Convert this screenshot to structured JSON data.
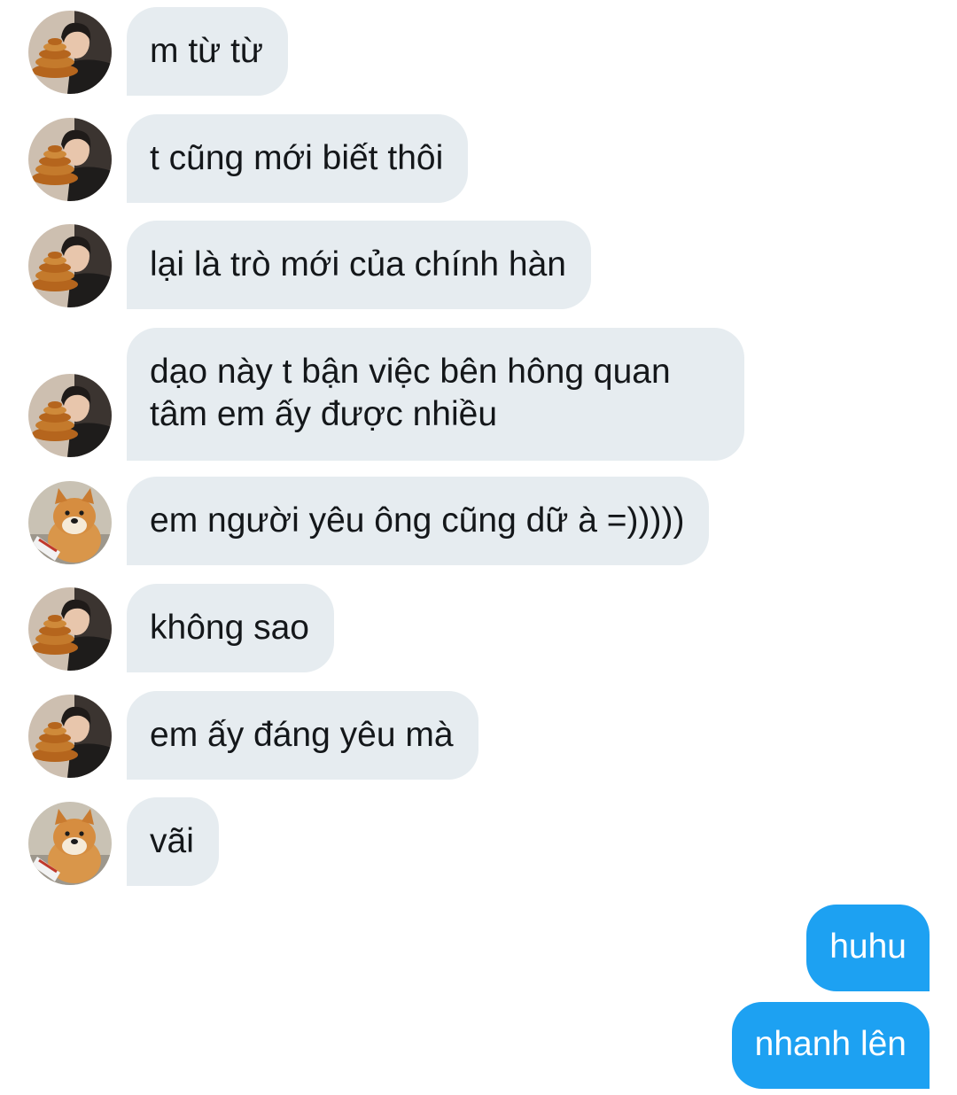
{
  "contacts": {
    "guy": {
      "icon": "person-avatar-icon"
    },
    "dog": {
      "icon": "shiba-dog-avatar-icon"
    }
  },
  "colors": {
    "incoming_bubble": "#e6ecf0",
    "outgoing_bubble": "#1da1f2",
    "incoming_text": "#14171a",
    "outgoing_text": "#ffffff"
  },
  "messages": [
    {
      "sender": "guy",
      "direction": "incoming",
      "text": "m từ từ"
    },
    {
      "sender": "guy",
      "direction": "incoming",
      "text": "t cũng mới biết thôi"
    },
    {
      "sender": "guy",
      "direction": "incoming",
      "text": "lại là trò mới của chính hàn"
    },
    {
      "sender": "guy",
      "direction": "incoming",
      "text": "dạo này t bận việc bên hông quan tâm em ấy được nhiều"
    },
    {
      "sender": "dog",
      "direction": "incoming",
      "text": "em người yêu ông cũng dữ à =)))))"
    },
    {
      "sender": "guy",
      "direction": "incoming",
      "text": "không sao"
    },
    {
      "sender": "guy",
      "direction": "incoming",
      "text": "em ấy đáng yêu mà"
    },
    {
      "sender": "dog",
      "direction": "incoming",
      "text": "vãi"
    },
    {
      "sender": "me",
      "direction": "outgoing",
      "text": "huhu"
    },
    {
      "sender": "me",
      "direction": "outgoing",
      "text": "nhanh lên"
    }
  ]
}
